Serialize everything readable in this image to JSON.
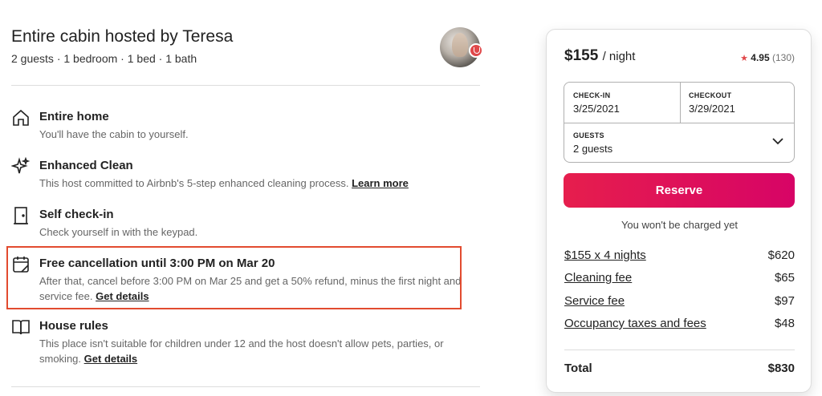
{
  "listing": {
    "host_title": "Entire cabin hosted by Teresa",
    "summary": "2 guests · 1 bedroom · 1 bed · 1 bath"
  },
  "features": [
    {
      "icon": "home-icon",
      "title": "Entire home",
      "desc": "You'll have the cabin to yourself.",
      "link": ""
    },
    {
      "icon": "sparkle-icon",
      "title": "Enhanced Clean",
      "desc": "This host committed to Airbnb's 5-step enhanced cleaning process.",
      "link": "Learn more"
    },
    {
      "icon": "door-icon",
      "title": "Self check-in",
      "desc": "Check yourself in with the keypad.",
      "link": ""
    },
    {
      "icon": "calendar-icon",
      "title": "Free cancellation until 3:00 PM on Mar 20",
      "desc": "After that, cancel before 3:00 PM on Mar 25 and get a 50% refund, minus the first night and service fee.",
      "link": "Get details"
    },
    {
      "icon": "book-icon",
      "title": "House rules",
      "desc": "This place isn't suitable for children under 12 and the host doesn't allow pets, parties, or smoking.",
      "link": "Get details"
    }
  ],
  "booking": {
    "price": "$155",
    "price_unit": "/ night",
    "rating": "4.95",
    "reviews": "(130)",
    "checkin_label": "CHECK-IN",
    "checkin_value": "3/25/2021",
    "checkout_label": "CHECKOUT",
    "checkout_value": "3/29/2021",
    "guests_label": "GUESTS",
    "guests_value": "2 guests",
    "reserve_label": "Reserve",
    "notice": "You won't be charged yet",
    "lines": [
      {
        "label": "$155 x 4 nights",
        "amount": "$620"
      },
      {
        "label": "Cleaning fee",
        "amount": "$65"
      },
      {
        "label": "Service fee",
        "amount": "$97"
      },
      {
        "label": "Occupancy taxes and fees",
        "amount": "$48"
      }
    ],
    "total_label": "Total",
    "total_amount": "$830"
  },
  "colors": {
    "accent": "#e61e4d",
    "highlight": "#e24b2f",
    "star": "#e0484a"
  }
}
